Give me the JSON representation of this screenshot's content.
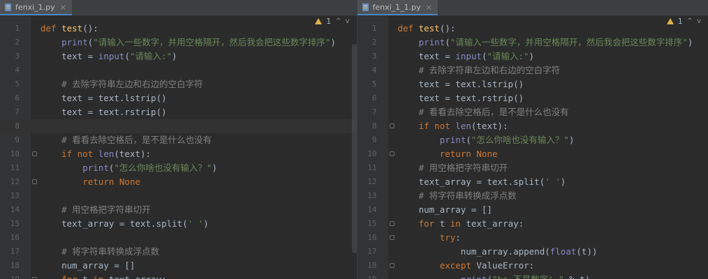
{
  "left": {
    "tab": {
      "filename": "fenxi_1.py",
      "close": "×"
    },
    "indicators": {
      "warnings": "1",
      "up": "^",
      "down": "v"
    },
    "lines": [
      {
        "n": "1",
        "tokens": [
          [
            "kw",
            "def "
          ],
          [
            "fn",
            "test"
          ],
          [
            "pl",
            "():"
          ]
        ]
      },
      {
        "n": "2",
        "tokens": [
          [
            "pl",
            "    "
          ],
          [
            "bi",
            "print"
          ],
          [
            "pl",
            "("
          ],
          [
            "str",
            "\"请输入一些数字，并用空格隔开，然后我会把这些数字排序\""
          ],
          [
            "pl",
            ")"
          ]
        ]
      },
      {
        "n": "3",
        "tokens": [
          [
            "pl",
            "    text = "
          ],
          [
            "bi",
            "input"
          ],
          [
            "pl",
            "("
          ],
          [
            "str",
            "\"请输入:\""
          ],
          [
            "pl",
            ")"
          ]
        ]
      },
      {
        "n": "4",
        "tokens": []
      },
      {
        "n": "5",
        "tokens": [
          [
            "pl",
            "    "
          ],
          [
            "cm",
            "# 去除字符串左边和右边的空白字符"
          ]
        ]
      },
      {
        "n": "6",
        "tokens": [
          [
            "pl",
            "    text = text.lstrip()"
          ]
        ]
      },
      {
        "n": "7",
        "tokens": [
          [
            "pl",
            "    text = text.rstrip()"
          ]
        ]
      },
      {
        "n": "8",
        "tokens": [],
        "current": true
      },
      {
        "n": "9",
        "tokens": [
          [
            "pl",
            "    "
          ],
          [
            "cm",
            "# 看看去除空格后，是不是什么也没有"
          ]
        ]
      },
      {
        "n": "10",
        "tokens": [
          [
            "pl",
            "    "
          ],
          [
            "kw",
            "if not "
          ],
          [
            "bi",
            "len"
          ],
          [
            "pl",
            "(text):"
          ]
        ],
        "fold": true
      },
      {
        "n": "11",
        "tokens": [
          [
            "pl",
            "        "
          ],
          [
            "bi",
            "print"
          ],
          [
            "pl",
            "("
          ],
          [
            "str",
            "\"怎么你啥也没有输入？\""
          ],
          [
            "pl",
            ")"
          ]
        ]
      },
      {
        "n": "12",
        "tokens": [
          [
            "pl",
            "        "
          ],
          [
            "kw",
            "return None"
          ]
        ],
        "fold": true
      },
      {
        "n": "13",
        "tokens": []
      },
      {
        "n": "14",
        "tokens": [
          [
            "pl",
            "    "
          ],
          [
            "cm",
            "# 用空格把字符串切开"
          ]
        ]
      },
      {
        "n": "15",
        "tokens": [
          [
            "pl",
            "    text_array = text.split("
          ],
          [
            "str",
            "' '"
          ],
          [
            "pl",
            ")"
          ]
        ]
      },
      {
        "n": "16",
        "tokens": []
      },
      {
        "n": "17",
        "tokens": [
          [
            "pl",
            "    "
          ],
          [
            "cm",
            "# 将字符串转换成浮点数"
          ]
        ]
      },
      {
        "n": "18",
        "tokens": [
          [
            "pl",
            "    num_array = []"
          ]
        ]
      },
      {
        "n": "19",
        "tokens": [
          [
            "pl",
            "    "
          ],
          [
            "kw",
            "for "
          ],
          [
            "pl",
            "t "
          ],
          [
            "kw",
            "in "
          ],
          [
            "pl",
            "text_array:"
          ]
        ],
        "fold": true
      }
    ]
  },
  "right": {
    "tab": {
      "filename": "fenxi_1_1.py",
      "close": "×"
    },
    "indicators": {
      "warnings": "1",
      "up": "^",
      "down": "v"
    },
    "lines": [
      {
        "n": "1",
        "tokens": [
          [
            "kw",
            "def "
          ],
          [
            "fn",
            "test"
          ],
          [
            "pl",
            "():"
          ]
        ]
      },
      {
        "n": "2",
        "tokens": [
          [
            "pl",
            "    "
          ],
          [
            "bi",
            "print"
          ],
          [
            "pl",
            "("
          ],
          [
            "str",
            "\"请输入一些数字，并用空格隔开，然后我会把这些数字排序\""
          ],
          [
            "pl",
            ")"
          ]
        ]
      },
      {
        "n": "3",
        "tokens": [
          [
            "pl",
            "    text = "
          ],
          [
            "bi",
            "input"
          ],
          [
            "pl",
            "("
          ],
          [
            "str",
            "\"请输入:\""
          ],
          [
            "pl",
            ")"
          ]
        ]
      },
      {
        "n": "4",
        "tokens": [
          [
            "pl",
            "    "
          ],
          [
            "cm",
            "# 去除字符串左边和右边的空白字符"
          ]
        ]
      },
      {
        "n": "5",
        "tokens": [
          [
            "pl",
            "    text = text.lstrip()"
          ]
        ]
      },
      {
        "n": "6",
        "tokens": [
          [
            "pl",
            "    text = text.rstrip()"
          ]
        ]
      },
      {
        "n": "7",
        "tokens": [
          [
            "pl",
            "    "
          ],
          [
            "cm",
            "# 看看去除空格后，是不是什么也没有"
          ]
        ]
      },
      {
        "n": "8",
        "tokens": [
          [
            "pl",
            "    "
          ],
          [
            "kw",
            "if not "
          ],
          [
            "bi",
            "len"
          ],
          [
            "pl",
            "(text):"
          ]
        ],
        "fold": true
      },
      {
        "n": "9",
        "tokens": [
          [
            "pl",
            "        "
          ],
          [
            "bi",
            "print"
          ],
          [
            "pl",
            "("
          ],
          [
            "str",
            "\"怎么你啥也没有输入？\""
          ],
          [
            "pl",
            ")"
          ]
        ]
      },
      {
        "n": "10",
        "tokens": [
          [
            "pl",
            "        "
          ],
          [
            "kw",
            "return None"
          ]
        ],
        "fold": true
      },
      {
        "n": "11",
        "tokens": [
          [
            "pl",
            "    "
          ],
          [
            "cm",
            "# 用空格把字符串切开"
          ]
        ]
      },
      {
        "n": "12",
        "tokens": [
          [
            "pl",
            "    text_array = text.split("
          ],
          [
            "str",
            "' '"
          ],
          [
            "pl",
            ")"
          ]
        ]
      },
      {
        "n": "13",
        "tokens": [
          [
            "pl",
            "    "
          ],
          [
            "cm",
            "# 将字符串转换成浮点数"
          ]
        ]
      },
      {
        "n": "14",
        "tokens": [
          [
            "pl",
            "    num_array = []"
          ]
        ]
      },
      {
        "n": "15",
        "tokens": [
          [
            "pl",
            "    "
          ],
          [
            "kw",
            "for "
          ],
          [
            "pl",
            "t "
          ],
          [
            "kw",
            "in "
          ],
          [
            "pl",
            "text_array:"
          ]
        ],
        "fold": true
      },
      {
        "n": "16",
        "tokens": [
          [
            "pl",
            "        "
          ],
          [
            "kw",
            "try"
          ],
          [
            "pl",
            ":"
          ]
        ],
        "fold": true
      },
      {
        "n": "17",
        "tokens": [
          [
            "pl",
            "            num_array.append("
          ],
          [
            "bi",
            "float"
          ],
          [
            "pl",
            "(t))"
          ]
        ]
      },
      {
        "n": "18",
        "tokens": [
          [
            "pl",
            "        "
          ],
          [
            "kw",
            "except "
          ],
          [
            "pl",
            "ValueError:"
          ]
        ],
        "fold": true
      },
      {
        "n": "19",
        "tokens": [
          [
            "pl",
            "            "
          ],
          [
            "bi",
            "print"
          ],
          [
            "pl",
            "("
          ],
          [
            "str",
            "\"%s 不是数字! \""
          ],
          [
            "pl",
            " % t)"
          ]
        ]
      }
    ]
  },
  "colors": {
    "background": "#2b2b2b",
    "keyword": "#cc7832",
    "function": "#ffc66d",
    "builtin": "#8888c6",
    "string": "#6a8759",
    "comment": "#808080",
    "text": "#a9b7c6",
    "warning": "#e0b04a"
  },
  "icons": {
    "file": "python-file-icon",
    "warning": "warning-triangle-icon",
    "close": "close-icon"
  }
}
